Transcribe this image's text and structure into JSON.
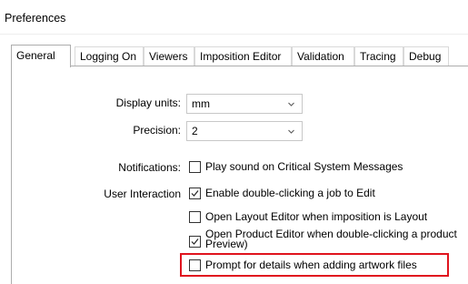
{
  "window": {
    "title": "Preferences"
  },
  "tabs": [
    {
      "label": "General",
      "active": true
    },
    {
      "label": "Logging On",
      "active": false
    },
    {
      "label": "Viewers",
      "active": false
    },
    {
      "label": "Imposition Editor",
      "active": false
    },
    {
      "label": "Validation",
      "active": false
    },
    {
      "label": "Tracing",
      "active": false
    },
    {
      "label": "Debug",
      "active": false
    }
  ],
  "general": {
    "display_units": {
      "label": "Display units:",
      "value": "mm"
    },
    "precision": {
      "label": "Precision:",
      "value": "2"
    },
    "notifications": {
      "label": "Notifications:",
      "play_sound": {
        "label": "Play sound on Critical System Messages",
        "checked": false
      }
    },
    "user_interaction": {
      "label": "User Interaction",
      "enable_double_click": {
        "label": "Enable double-clicking a job to Edit",
        "checked": true
      },
      "open_layout_editor": {
        "label": "Open Layout Editor when imposition is Layout",
        "checked": false
      },
      "open_product_editor": {
        "label_line1": "Open Product Editor when double-clicking a product",
        "label_line2": "Preview)",
        "checked": true
      },
      "prompt_artwork": {
        "label": "Prompt for details when adding artwork files",
        "checked": false
      }
    }
  },
  "annotation": {
    "highlight_color": "#e0141e"
  }
}
